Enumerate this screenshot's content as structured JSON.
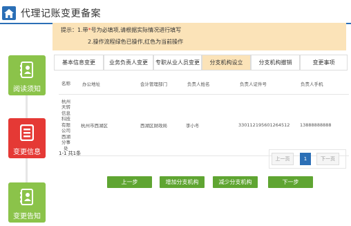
{
  "header": {
    "title": "代理记账变更备案",
    "corner_text": "..."
  },
  "notice": {
    "prefix": "提示：1.带",
    "star": "*",
    "line1_rest": "号为必填项,请根据实际情况进行填写",
    "line2": "2.操作流程绿色已操作,红色为当前操作"
  },
  "steps": [
    {
      "label": "阅读须知",
      "state": "done"
    },
    {
      "label": "变更信息",
      "state": "current"
    },
    {
      "label": "变更告知",
      "state": "done"
    }
  ],
  "tabs": [
    {
      "label": "基本信息变更"
    },
    {
      "label": "业务负责人变更"
    },
    {
      "label": "专职从业人员变更"
    },
    {
      "label": "分支机构设立"
    },
    {
      "label": "分支机构撤销"
    },
    {
      "label": "变更事项"
    }
  ],
  "table": {
    "headers": [
      "名称",
      "办公地址",
      "会计管理部门",
      "负责人姓名",
      "负责人证件号",
      "负责人手机"
    ],
    "rows": [
      {
        "name": "杭州天转信息科技有限公司西湖分事处",
        "address": "杭州市西湖区",
        "dept": "西湖区财政局",
        "manager": "李小冬",
        "id_no": "330112195601264512",
        "phone": "13888888888"
      }
    ]
  },
  "pagination": {
    "summary": "1-1 共1条",
    "prev": "上一页",
    "current": "1",
    "next": "下一页"
  },
  "buttons": {
    "prev_step": "上一步",
    "add_branch": "增加分支机构",
    "remove_branch": "减少分支机构",
    "next_step": "下一步"
  },
  "colors": {
    "accent": "#2b6fb6",
    "done": "#8bc34a",
    "current": "#e53935",
    "notice_bg": "#fbe3b8",
    "button": "#5fa532"
  }
}
